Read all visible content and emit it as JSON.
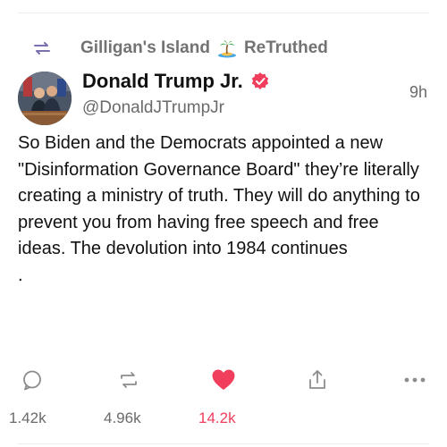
{
  "retruth": {
    "username": "Gilligan's Island",
    "label": "ReTruthed"
  },
  "author": {
    "display_name": "Donald Trump Jr.",
    "handle": "@DonaldJTrumpJr",
    "verified": true
  },
  "post": {
    "time": "9h",
    "text": "So Biden and the Democrats appointed a new \"Disinformation Governance Board\" they’re literally creating a ministry of truth. They will do anything to prevent you from having free speech and free ideas. The devolution into 1984 continues\n."
  },
  "actions": {
    "replies": "1.42k",
    "retruths": "4.96k",
    "likes": "14.2k"
  },
  "colors": {
    "like_active": "#f03e5c",
    "verified_badge": "#f03e5c",
    "muted_text": "#6a6a6a"
  },
  "icons": [
    "retruth-icon",
    "island-emoji-icon",
    "verified-badge-icon",
    "reply-icon",
    "retruth-action-icon",
    "heart-icon",
    "share-icon",
    "more-icon"
  ]
}
